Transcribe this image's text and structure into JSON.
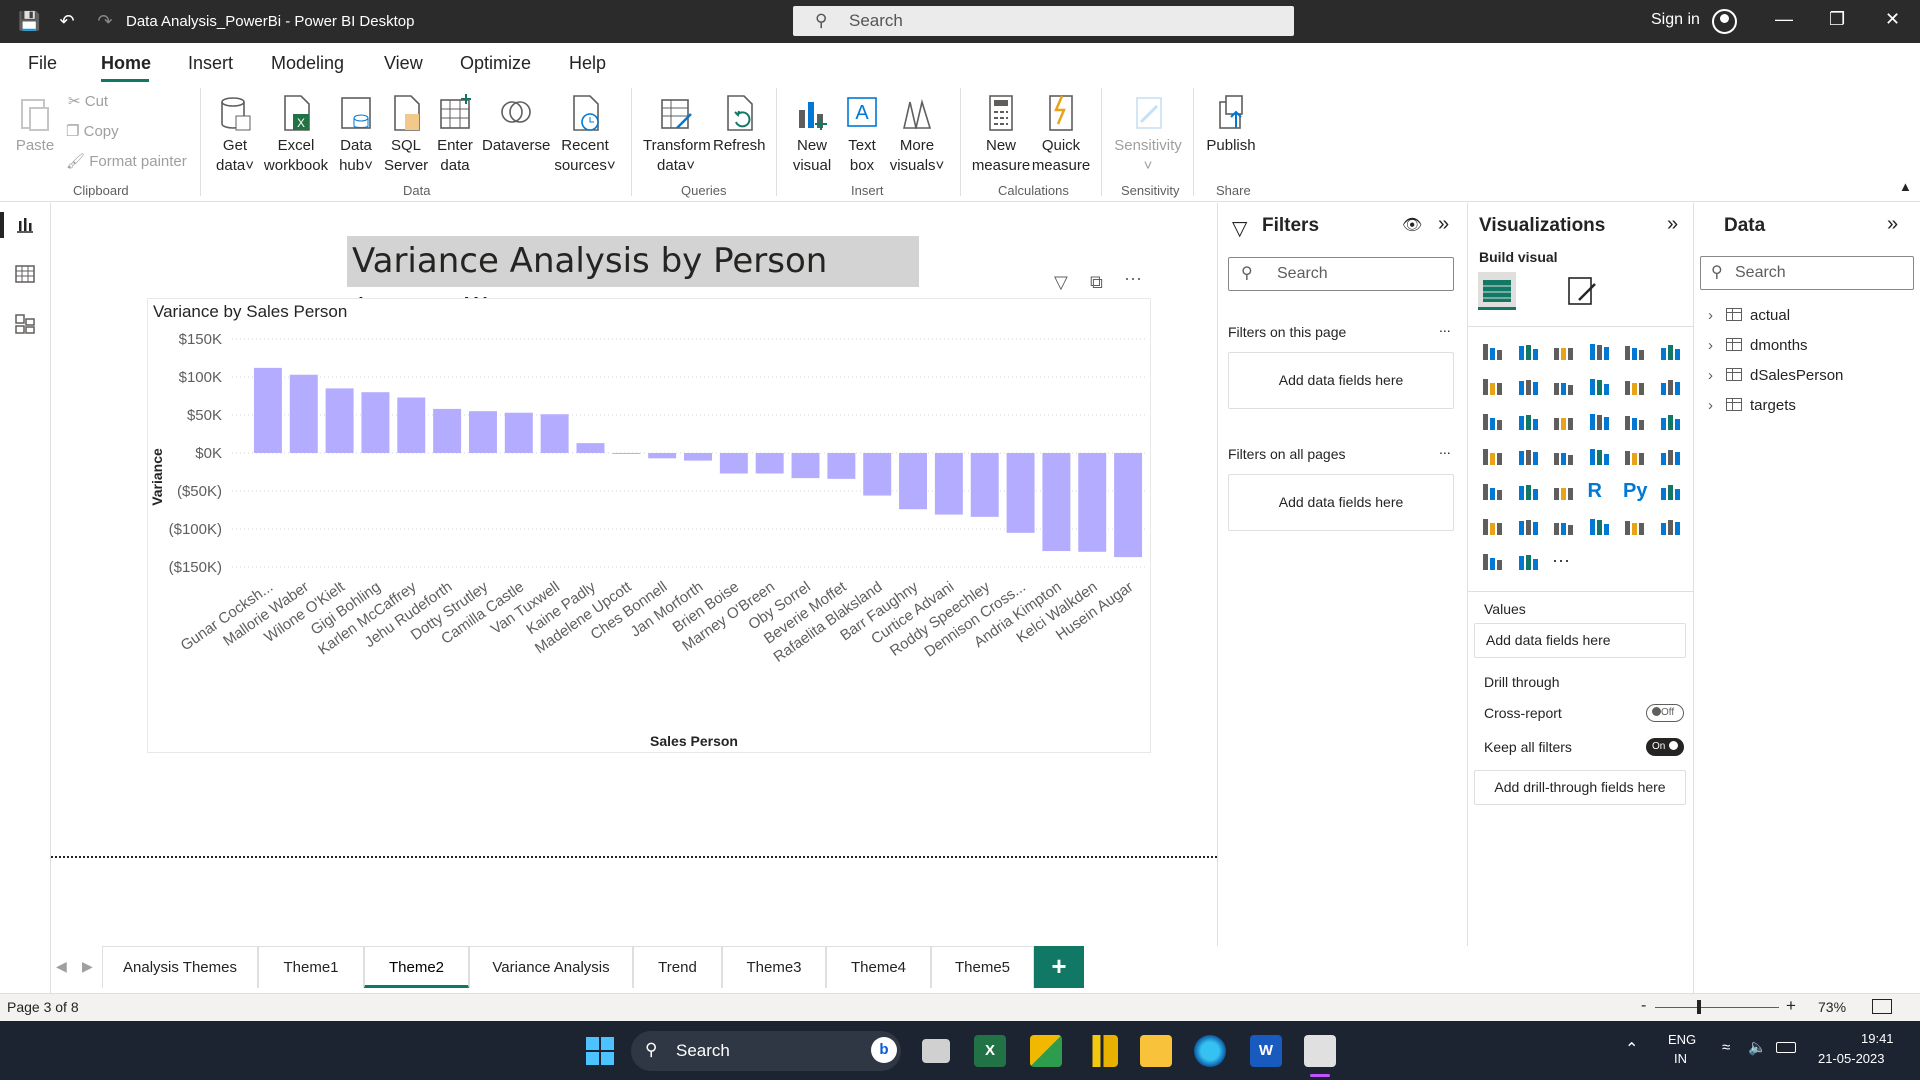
{
  "window": {
    "title": "Data Analysis_PowerBi - Power BI Desktop",
    "search_placeholder": "Search",
    "sign_in": "Sign in"
  },
  "menu": {
    "items": [
      "File",
      "Home",
      "Insert",
      "Modeling",
      "View",
      "Optimize",
      "Help"
    ],
    "active": "Home"
  },
  "ribbon": {
    "clipboard": {
      "paste": "Paste",
      "cut": "Cut",
      "copy": "Copy",
      "format_painter": "Format painter",
      "group": "Clipboard"
    },
    "data": {
      "get_data": [
        "Get",
        "data"
      ],
      "excel": [
        "Excel",
        "workbook"
      ],
      "data_hub": [
        "Data",
        "hub"
      ],
      "sql": [
        "SQL",
        "Server"
      ],
      "enter": [
        "Enter",
        "data"
      ],
      "dataverse": "Dataverse",
      "recent": [
        "Recent",
        "sources"
      ],
      "group": "Data"
    },
    "queries": {
      "transform": [
        "Transform",
        "data"
      ],
      "refresh": "Refresh",
      "group": "Queries"
    },
    "insert": {
      "new_visual": [
        "New",
        "visual"
      ],
      "text_box": [
        "Text",
        "box"
      ],
      "more_visuals": [
        "More",
        "visuals"
      ],
      "group": "Insert"
    },
    "calculations": {
      "new_measure": [
        "New",
        "measure"
      ],
      "quick_measure": [
        "Quick",
        "measure"
      ],
      "group": "Calculations"
    },
    "sensitivity": {
      "label": "Sensitivity",
      "group": "Sensitivity"
    },
    "share": {
      "publish": "Publish",
      "group": "Share"
    }
  },
  "report": {
    "title": "Variance Analysis by Person (overall)"
  },
  "chart_data": {
    "type": "bar",
    "title": "Variance by Sales Person",
    "xlabel": "Sales Person",
    "ylabel": "Variance",
    "ylim": [
      -150000,
      150000
    ],
    "yticks": [
      "$150K",
      "$100K",
      "$50K",
      "$0K",
      "($50K)",
      "($100K)",
      "($150K)"
    ],
    "bar_color": "#b3acff",
    "categories": [
      "Gunar Cocksh...",
      "Mallorie Waber",
      "Wilone O'Kielt",
      "Gigi Bohling",
      "Karlen McCaffrey",
      "Jehu Rudeforth",
      "Dotty Strutley",
      "Camilla Castle",
      "Van Tuxwell",
      "Kaine Padly",
      "Madelene Upcott",
      "Ches Bonnell",
      "Jan Morforth",
      "Brien Boise",
      "Marney O'Breen",
      "Oby Sorrel",
      "Beverie Moffet",
      "Rafaelita Blaksland",
      "Barr Faughny",
      "Curtice Advani",
      "Roddy Speechley",
      "Dennison Cross...",
      "Andria Kimpton",
      "Kelci Walkden",
      "Husein Augar"
    ],
    "values": [
      112000,
      103000,
      85000,
      80000,
      73000,
      58000,
      55000,
      53000,
      51000,
      13000,
      -1000,
      -7000,
      -10000,
      -27000,
      -27000,
      -33000,
      -34000,
      -56000,
      -74000,
      -81000,
      -84000,
      -105000,
      -129000,
      -130000,
      -137000
    ],
    "grid": true
  },
  "filters": {
    "title": "Filters",
    "search": "Search",
    "on_page": "Filters on this page",
    "on_all": "Filters on all pages",
    "add_fields": "Add data fields here",
    "more": "..."
  },
  "visualizations": {
    "title": "Visualizations",
    "build": "Build visual",
    "values": "Values",
    "add_fields": "Add data fields here",
    "drill": "Drill through",
    "cross_report": "Cross-report",
    "cross_report_state": "Off",
    "keep_filters": "Keep all filters",
    "keep_filters_state": "On",
    "add_drill": "Add drill-through fields here",
    "r_label": "R",
    "py_label": "Py",
    "ellipsis": "···"
  },
  "data_pane": {
    "title": "Data",
    "search": "Search",
    "tables": [
      "actual",
      "dmonths",
      "dSalesPerson",
      "targets"
    ]
  },
  "tabs": {
    "items": [
      "Analysis Themes",
      "Theme1",
      "Theme2",
      "Variance Analysis",
      "Trend",
      "Theme3",
      "Theme4",
      "Theme5"
    ],
    "active": "Theme2"
  },
  "status": {
    "page": "Page 3 of 8",
    "zoom": "73%"
  },
  "taskbar": {
    "search": "Search",
    "lang1": "ENG",
    "lang2": "IN",
    "time": "19:41",
    "date": "21-05-2023"
  }
}
